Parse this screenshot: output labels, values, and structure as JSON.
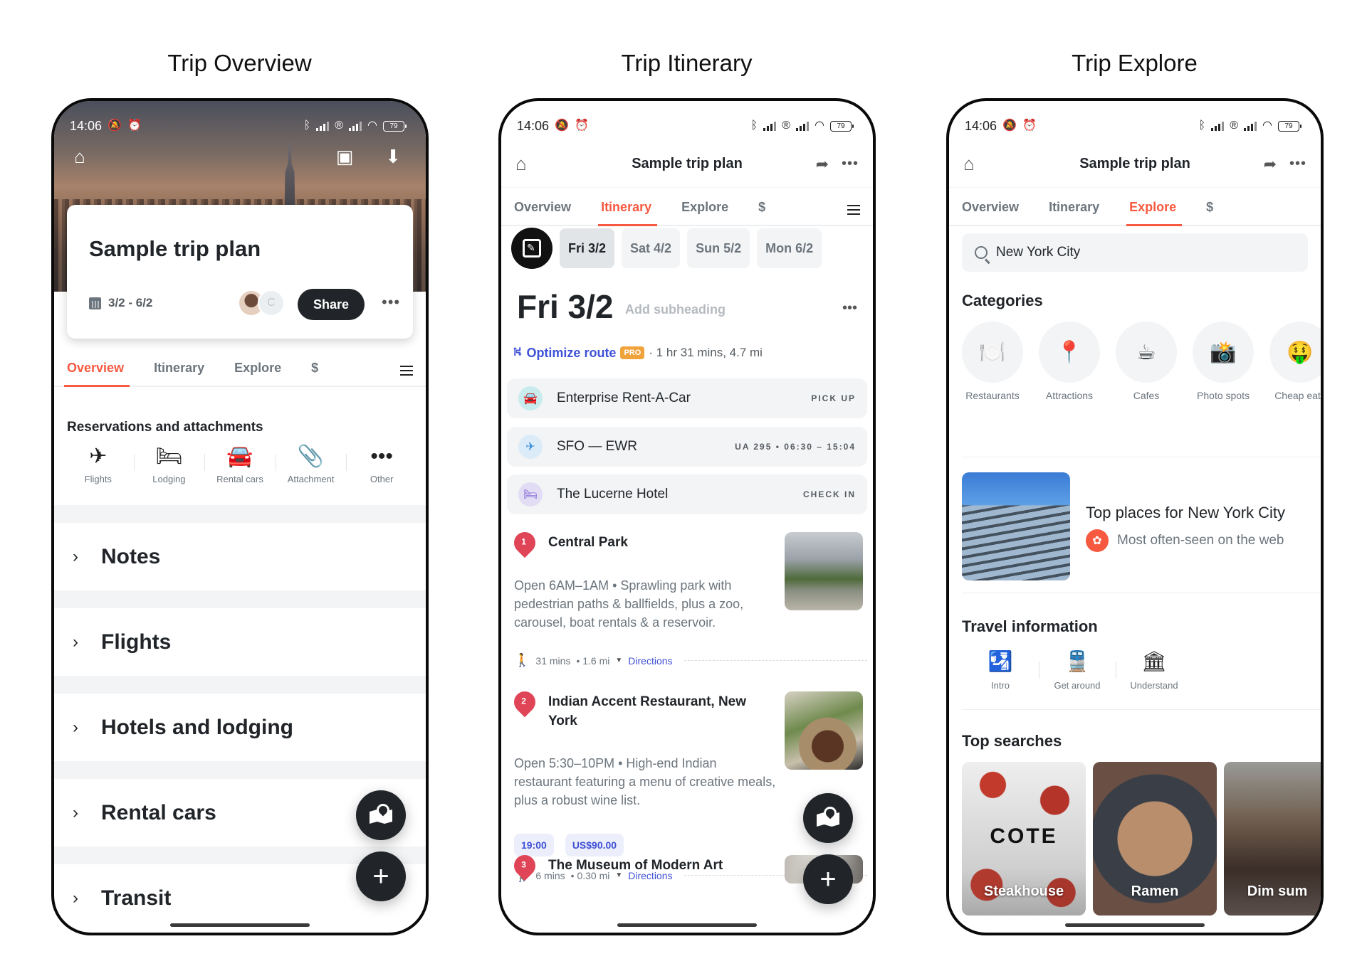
{
  "screens": [
    {
      "title": "Trip Overview"
    },
    {
      "title": "Trip Itinerary"
    },
    {
      "title": "Trip Explore"
    }
  ],
  "status_bar": {
    "time": "14:06",
    "battery": "79"
  },
  "trip": {
    "title": "Sample trip plan",
    "dates": "3/2 - 6/2",
    "collaborator_initial": "C",
    "share_label": "Share"
  },
  "tabs": [
    "Overview",
    "Itinerary",
    "Explore",
    "$"
  ],
  "overview": {
    "reservations_heading": "Reservations and attachments",
    "reservation_types": [
      {
        "label": "Flights",
        "icon": "airplane-icon"
      },
      {
        "label": "Lodging",
        "icon": "bed-icon"
      },
      {
        "label": "Rental cars",
        "icon": "car-icon"
      },
      {
        "label": "Attachment",
        "icon": "paperclip-icon"
      },
      {
        "label": "Other",
        "icon": "more-icon"
      }
    ],
    "sections": [
      "Notes",
      "Flights",
      "Hotels and lodging",
      "Rental cars",
      "Transit"
    ]
  },
  "itinerary": {
    "days": [
      "Fri 3/2",
      "Sat 4/2",
      "Sun 5/2",
      "Mon 6/2"
    ],
    "selected_day": "Fri 3/2",
    "day_heading": "Fri 3/2",
    "subheading_placeholder": "Add subheading",
    "optimize_label": "Optimize route",
    "pro_badge": "PRO",
    "route_summary": "· 1 hr 31 mins, 4.7 mi",
    "reservations": [
      {
        "name": "Enterprise Rent-A-Car",
        "tag": "PICK UP",
        "icon": "car-icon"
      },
      {
        "name": "SFO — EWR",
        "tag": "UA 295 • 06:30 – 15:04",
        "icon": "airplane-icon"
      },
      {
        "name": "The Lucerne Hotel",
        "tag": "CHECK IN",
        "icon": "bed-icon"
      }
    ],
    "places": [
      {
        "number": "1",
        "name": "Central Park",
        "description": "Open 6AM–1AM • Sprawling park with pedestrian paths & ballfields, plus a zoo, carousel, boat rentals & a reservoir."
      },
      {
        "number": "2",
        "name": "Indian Accent Restaurant, New York",
        "description": "Open 5:30–10PM • High-end Indian restaurant featuring a menu of creative meals, plus a robust wine list.",
        "time": "19:00",
        "cost": "US$90.00"
      },
      {
        "number": "3",
        "name": "The Museum of Modern Art"
      }
    ],
    "travel_segments": [
      {
        "duration": "31 mins",
        "distance": "• 1.6 mi",
        "directions_label": "Directions"
      },
      {
        "duration": "6 mins",
        "distance": "• 0.30 mi",
        "directions_label": "Directions"
      }
    ]
  },
  "explore": {
    "search_value": "New York City",
    "categories_heading": "Categories",
    "categories": [
      {
        "label": "Restaurants",
        "emoji": "🍽️"
      },
      {
        "label": "Attractions",
        "emoji": "📍"
      },
      {
        "label": "Cafes",
        "emoji": "☕"
      },
      {
        "label": "Photo spots",
        "emoji": "📸"
      },
      {
        "label": "Cheap eats",
        "emoji": "🤑"
      }
    ],
    "top_places_title": "Top places for New York City",
    "top_places_subtitle": "Most often-seen on the web",
    "travel_info_heading": "Travel information",
    "travel_info": [
      {
        "label": "Intro",
        "icon": "passport-icon"
      },
      {
        "label": "Get around",
        "icon": "train-icon"
      },
      {
        "label": "Understand",
        "icon": "museum-icon"
      }
    ],
    "top_searches_heading": "Top searches",
    "top_searches": [
      {
        "label": "Steakhouse",
        "image_text": "COTE"
      },
      {
        "label": "Ramen"
      },
      {
        "label": "Dim sum"
      }
    ]
  },
  "colors": {
    "accent": "#f75940",
    "link": "#3f51d6",
    "pro": "#f0a23b",
    "pin": "#e04457",
    "dark": "#212529"
  }
}
